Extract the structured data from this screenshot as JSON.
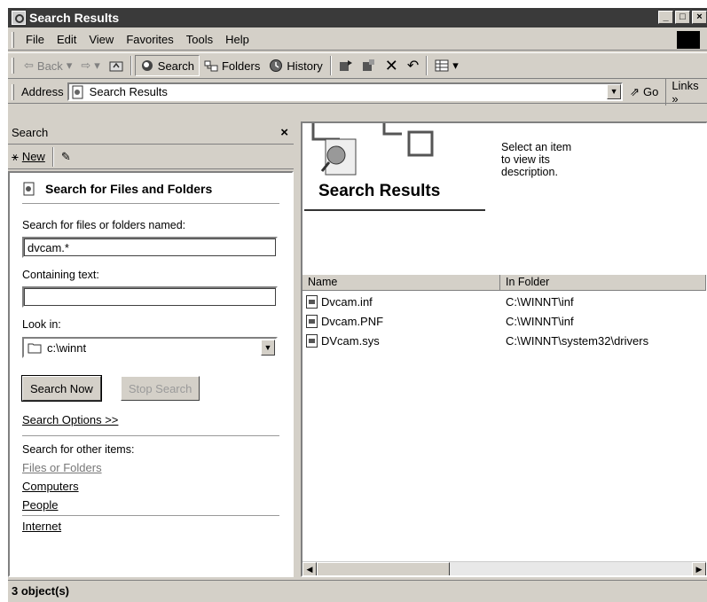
{
  "window": {
    "title": "Search Results"
  },
  "menu": [
    "File",
    "Edit",
    "View",
    "Favorites",
    "Tools",
    "Help"
  ],
  "toolbar": {
    "back": "Back",
    "search": "Search",
    "folders": "Folders",
    "history": "History"
  },
  "address": {
    "label": "Address",
    "value": "Search Results",
    "go": "Go",
    "links": "Links »"
  },
  "search_pane": {
    "header": "Search",
    "new_label": "New",
    "section_title": "Search for Files and Folders",
    "named_label": "Search for files or folders named:",
    "named_value": "dvcam.*",
    "containing_label": "Containing text:",
    "containing_value": "",
    "lookin_label": "Look in:",
    "lookin_value": "c:\\winnt",
    "search_now": "Search Now",
    "stop_search": "Stop Search",
    "options": "Search Options >>",
    "other_items": "Search for other items:",
    "links": [
      "Files or Folders",
      "Computers",
      "People"
    ],
    "internet": "Internet"
  },
  "results": {
    "title": "Search Results",
    "description": "Select an item to view its description.",
    "columns": [
      "Name",
      "In Folder"
    ],
    "rows": [
      {
        "name": "Dvcam.inf",
        "folder": "C:\\WINNT\\inf"
      },
      {
        "name": "Dvcam.PNF",
        "folder": "C:\\WINNT\\inf"
      },
      {
        "name": "DVcam.sys",
        "folder": "C:\\WINNT\\system32\\drivers"
      }
    ]
  },
  "status": {
    "text": "3 object(s)"
  }
}
